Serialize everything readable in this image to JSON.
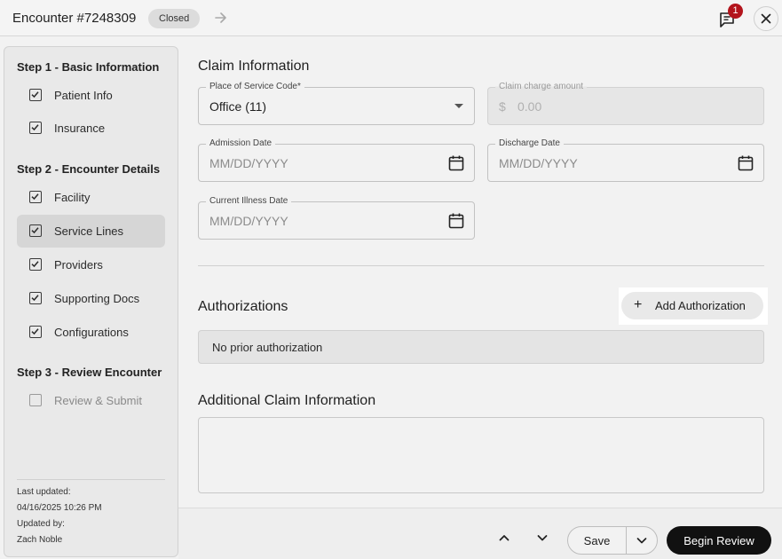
{
  "header": {
    "title": "Encounter #7248309",
    "status": "Closed",
    "notification_count": "1"
  },
  "sidebar": {
    "step1": "Step 1 - Basic Information",
    "step2": "Step 2 - Encounter Details",
    "step3": "Step 3 - Review Encounter",
    "items": [
      {
        "label": "Patient Info",
        "checked": true
      },
      {
        "label": "Insurance",
        "checked": true
      },
      {
        "label": "Facility",
        "checked": true
      },
      {
        "label": "Service Lines",
        "checked": true,
        "active": true
      },
      {
        "label": "Providers",
        "checked": true
      },
      {
        "label": "Supporting Docs",
        "checked": true
      },
      {
        "label": "Configurations",
        "checked": true
      },
      {
        "label": "Review & Submit",
        "checked": false
      }
    ],
    "meta": {
      "last_updated_label": "Last updated:",
      "last_updated_value": "04/16/2025 10:26 PM",
      "updated_by_label": "Updated by:",
      "updated_by_value": "Zach Noble"
    }
  },
  "claim": {
    "title": "Claim Information",
    "place_of_service": {
      "label": "Place of Service Code*",
      "value": "Office (11)"
    },
    "charge_amount": {
      "label": "Claim charge amount",
      "currency": "$",
      "value": "0.00"
    },
    "admission_date": {
      "label": "Admission Date",
      "placeholder": "MM/DD/YYYY"
    },
    "discharge_date": {
      "label": "Discharge Date",
      "placeholder": "MM/DD/YYYY"
    },
    "current_illness_date": {
      "label": "Current Illness Date",
      "placeholder": "MM/DD/YYYY"
    }
  },
  "authorizations": {
    "title": "Authorizations",
    "add_label": "Add Authorization",
    "empty_text": "No prior authorization"
  },
  "additional": {
    "title": "Additional Claim Information",
    "value": ""
  },
  "footer": {
    "save_label": "Save",
    "begin_label": "Begin Review"
  }
}
